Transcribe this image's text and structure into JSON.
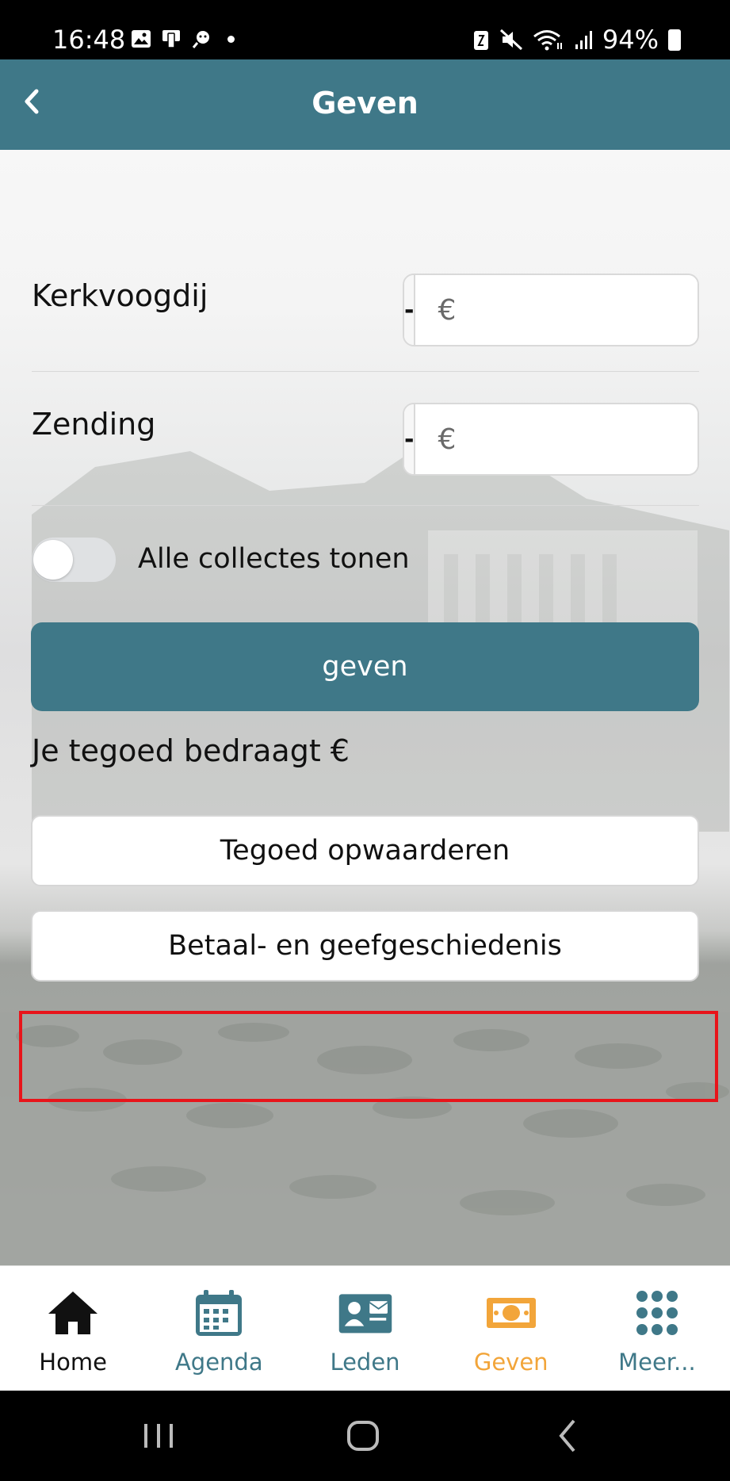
{
  "status_bar": {
    "time": "16:48",
    "battery_percent": "94%"
  },
  "header": {
    "title": "Geven"
  },
  "collections": [
    {
      "label": "Kerkvoogdij",
      "currency_placeholder": "€",
      "minus": "-",
      "plus": "+"
    },
    {
      "label": "Zending",
      "currency_placeholder": "€",
      "minus": "-",
      "plus": "+"
    }
  ],
  "toggle": {
    "label": "Alle collectes tonen",
    "on": false
  },
  "give_button": "geven",
  "balance_text": "Je tegoed bedraagt €",
  "buttons": {
    "top_up": "Tegoed opwaarderen",
    "history": "Betaal- en geefgeschiedenis"
  },
  "bottom_nav": [
    {
      "label": "Home",
      "icon": "home-icon",
      "color": "#111111"
    },
    {
      "label": "Agenda",
      "icon": "calendar-icon",
      "color": "#3f7888"
    },
    {
      "label": "Leden",
      "icon": "contact-card-icon",
      "color": "#3f7888"
    },
    {
      "label": "Geven",
      "icon": "money-icon",
      "color": "#f2a53a",
      "active": true
    },
    {
      "label": "Meer...",
      "icon": "grid-dots-icon",
      "color": "#3f7888"
    }
  ],
  "colors": {
    "primary": "#3f7888",
    "active_nav": "#f2a53a",
    "highlight": "#e8141a"
  }
}
